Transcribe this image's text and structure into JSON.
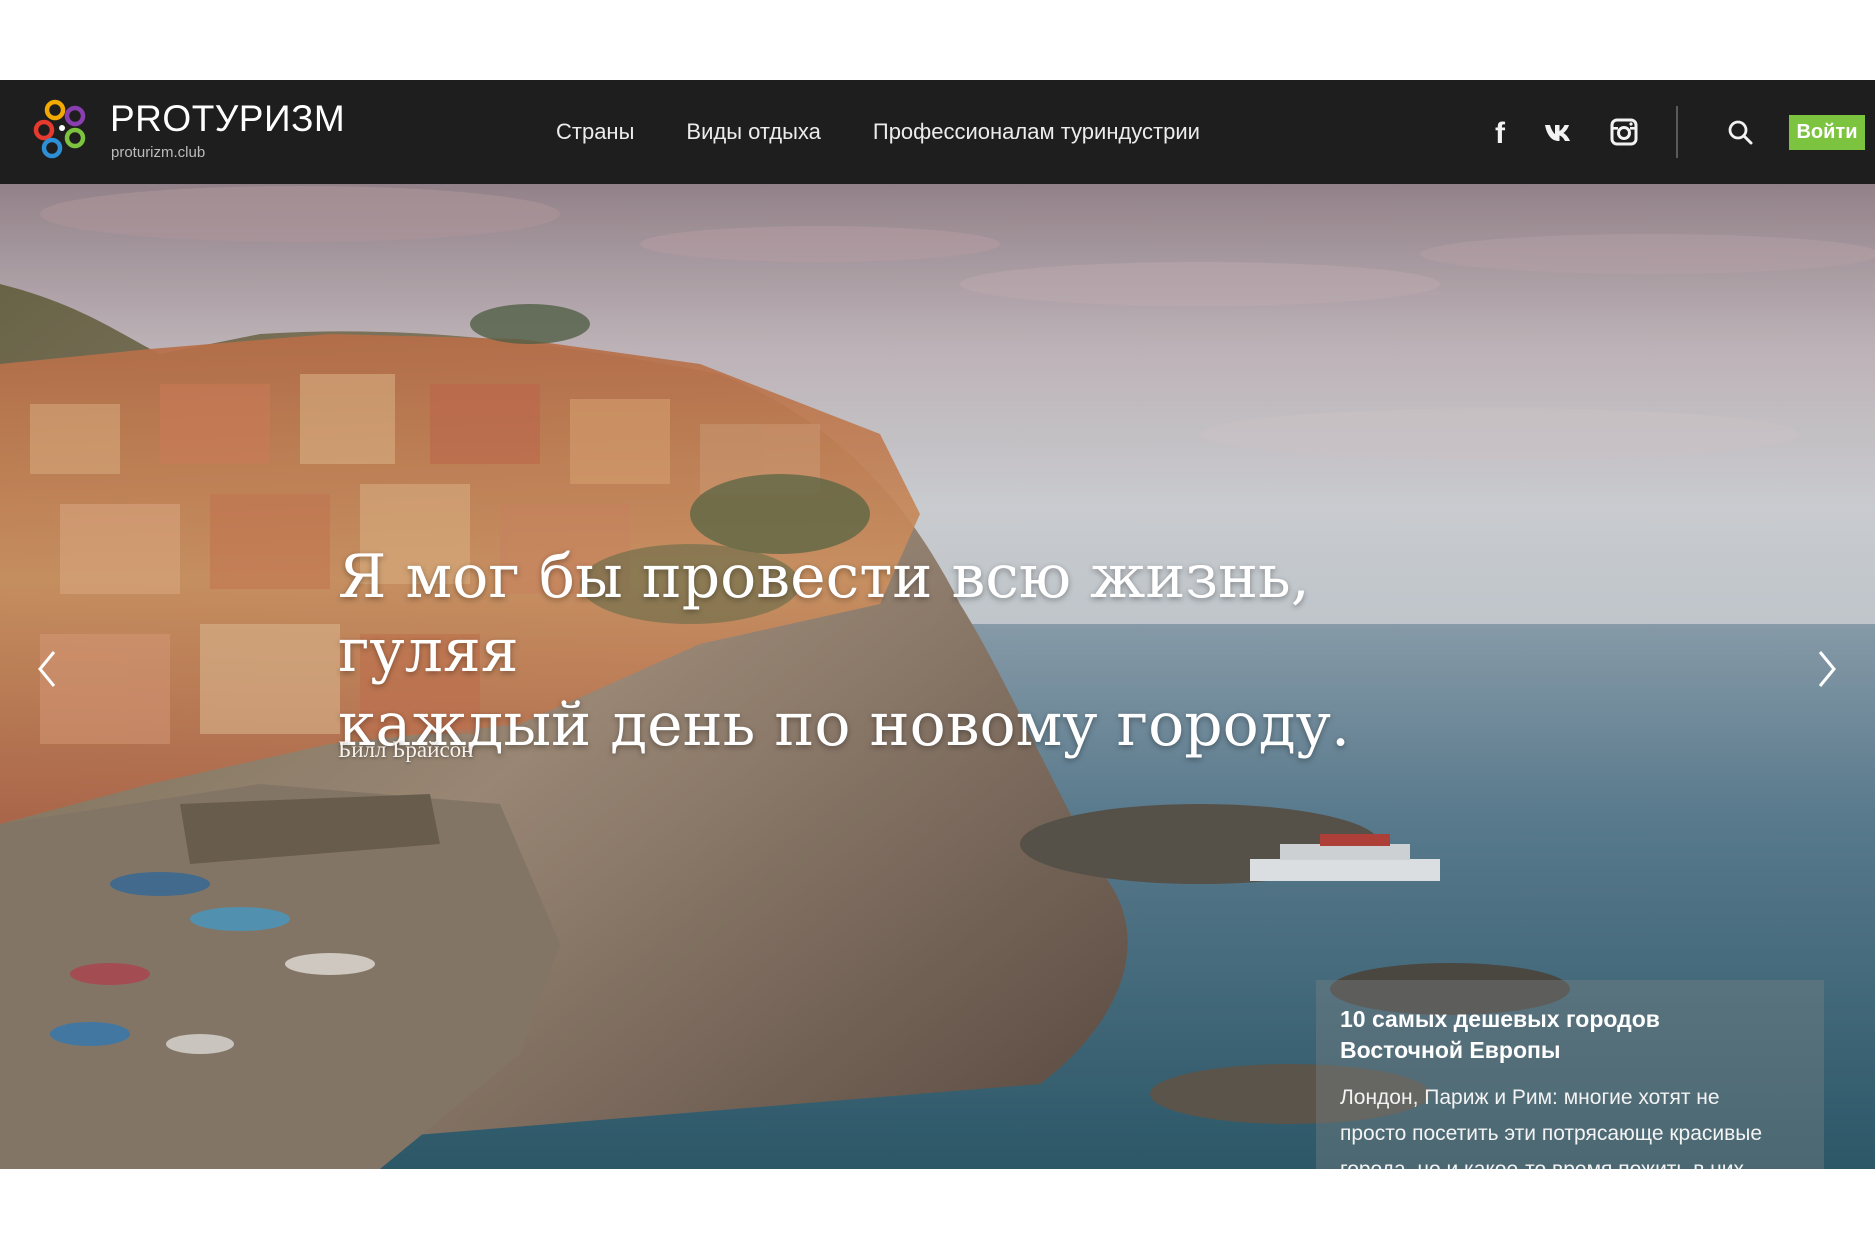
{
  "brand": {
    "name_latin": "PRO",
    "name_cyrillic": "ТУРИЗМ",
    "domain": "proturizm.club",
    "colors": [
      "#f2a900",
      "#8a3fb0",
      "#e63a2e",
      "#2d8fd6",
      "#7cc33f"
    ]
  },
  "nav": {
    "items": [
      "Страны",
      "Виды отдыха",
      "Профессионалам туриндустрии"
    ]
  },
  "social": {
    "icons": [
      "facebook-icon",
      "vk-icon",
      "instagram-icon"
    ],
    "facebook_glyph": "f"
  },
  "header": {
    "login_label": "Войти",
    "login_color": "#7cc33f",
    "background": "#1e1e1e"
  },
  "hero": {
    "quote_line1": "Я мог бы провести всю жизнь, гуляя",
    "quote_line2": "каждый день по новому городу.",
    "author": "Билл Брайсон",
    "arrows": [
      "chevron-left-icon",
      "chevron-right-icon"
    ]
  },
  "article_card": {
    "title": "10 самых дешевых городов Восточной Европы",
    "excerpt": "Лондон, Париж и Рим: многие хотят не просто посетить эти потрясающе красивые города, но и какое-то время пожить в них."
  }
}
